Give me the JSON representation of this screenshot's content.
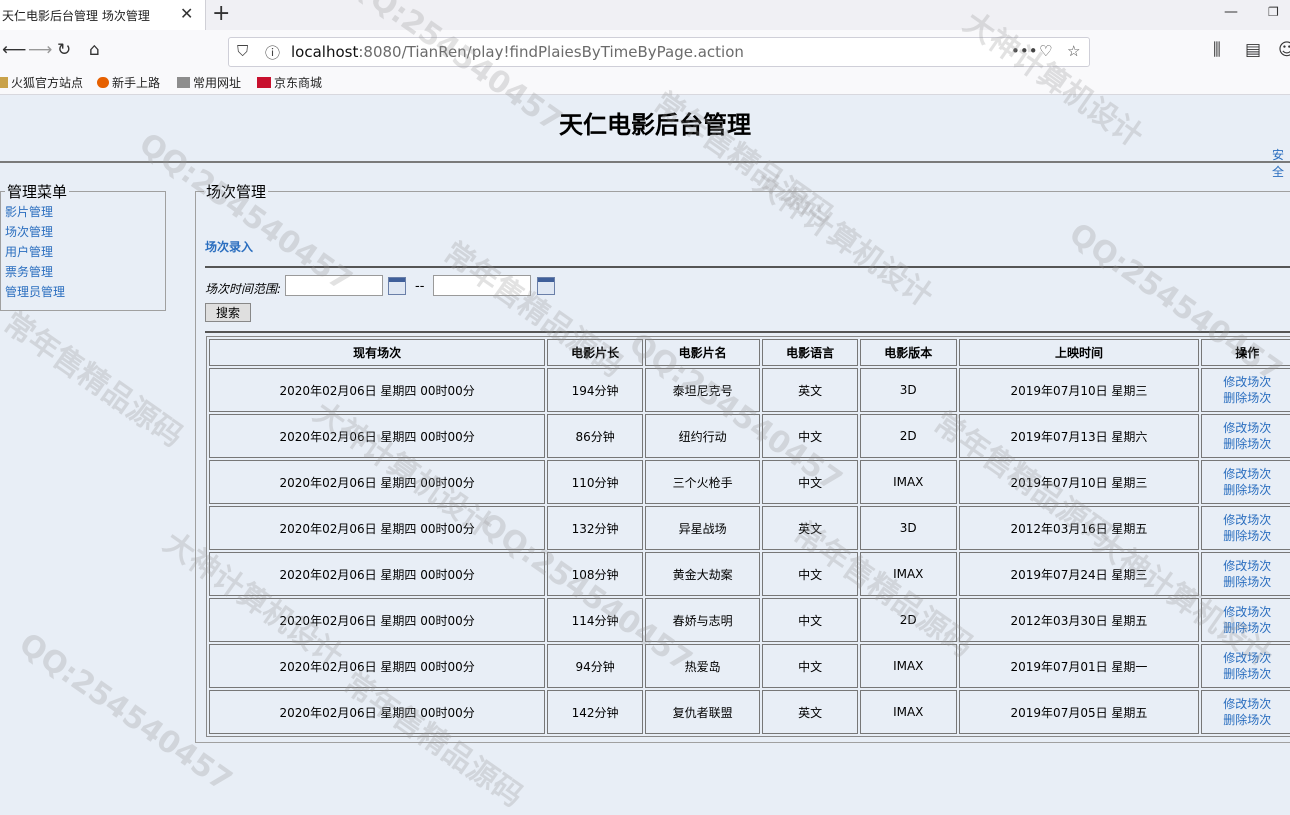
{
  "browser": {
    "tab_title": "天仁电影后台管理 场次管理",
    "url_host": "localhost",
    "url_path": ":8080/TianRen/play!findPlaiesByTimeByPage.action",
    "bookmarks": [
      "火狐官方站点",
      "新手上路",
      "常用网址",
      "京东商城"
    ]
  },
  "header": {
    "title": "天仁电影后台管理",
    "right_link": "安全"
  },
  "sidebar": {
    "legend": "管理菜单",
    "items": [
      "影片管理",
      "场次管理",
      "用户管理",
      "票务管理",
      "管理员管理"
    ]
  },
  "main": {
    "legend": "场次管理",
    "add_link": "场次录入",
    "range_label": "场次时间范围:",
    "range_sep": "--",
    "search_button": "搜索",
    "columns": [
      "现有场次",
      "电影片长",
      "电影片名",
      "电影语言",
      "电影版本",
      "上映时间",
      "操作"
    ],
    "rows": [
      [
        "2020年02月06日 星期四 00时00分",
        "194分钟",
        "泰坦尼克号",
        "英文",
        "3D",
        "2019年07月10日 星期三"
      ],
      [
        "2020年02月06日 星期四 00时00分",
        "86分钟",
        "纽约行动",
        "中文",
        "2D",
        "2019年07月13日 星期六"
      ],
      [
        "2020年02月06日 星期四 00时00分",
        "110分钟",
        "三个火枪手",
        "中文",
        "IMAX",
        "2019年07月10日 星期三"
      ],
      [
        "2020年02月06日 星期四 00时00分",
        "132分钟",
        "异星战场",
        "英文",
        "3D",
        "2012年03月16日 星期五"
      ],
      [
        "2020年02月06日 星期四 00时00分",
        "108分钟",
        "黄金大劫案",
        "中文",
        "IMAX",
        "2019年07月24日 星期三"
      ],
      [
        "2020年02月06日 星期四 00时00分",
        "114分钟",
        "春娇与志明",
        "中文",
        "2D",
        "2012年03月30日 星期五"
      ],
      [
        "2020年02月06日 星期四 00时00分",
        "94分钟",
        "热爱岛",
        "中文",
        "IMAX",
        "2019年07月01日 星期一"
      ],
      [
        "2020年02月06日 星期四 00时00分",
        "142分钟",
        "复仇者联盟",
        "英文",
        "IMAX",
        "2019年07月05日 星期五"
      ]
    ],
    "op_edit": "修改场次",
    "op_delete": "删除场次"
  },
  "watermarks": [
    "QQ:254540457",
    "常年售精品源码",
    "大神计算机设计",
    "QQ:254540457",
    "常年售精品源码",
    "大神计算机设计",
    "QQ:254540457",
    "常年售精品源码",
    "大神计算机设计"
  ]
}
